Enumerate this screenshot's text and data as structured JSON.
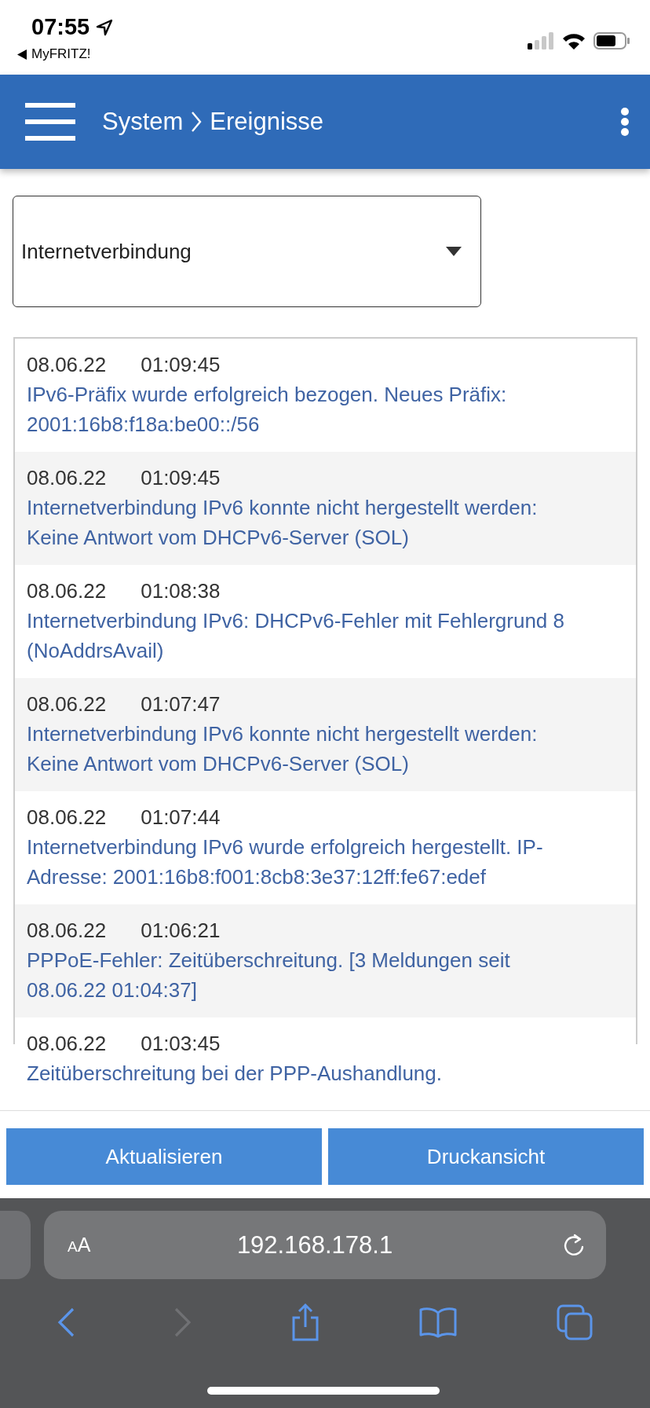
{
  "status_bar": {
    "time": "07:55",
    "back_app": "MyFRITZ!"
  },
  "header": {
    "breadcrumb": [
      "System",
      "Ereignisse"
    ]
  },
  "filter": {
    "value": "Internetverbindung"
  },
  "events": [
    {
      "date": "08.06.22",
      "time": "01:09:45",
      "message": "IPv6-Präfix wurde erfolgreich bezogen. Neues Präfix: 2001:16b8:f18a:be00::/56"
    },
    {
      "date": "08.06.22",
      "time": "01:09:45",
      "message": "Internetverbindung IPv6 konnte nicht hergestellt werden: Keine Antwort vom DHCPv6-Server (SOL)"
    },
    {
      "date": "08.06.22",
      "time": "01:08:38",
      "message": "Internetverbindung IPv6: DHCPv6-Fehler mit Fehlergrund 8 (NoAddrsAvail)"
    },
    {
      "date": "08.06.22",
      "time": "01:07:47",
      "message": "Internetverbindung IPv6 konnte nicht hergestellt werden: Keine Antwort vom DHCPv6-Server (SOL)"
    },
    {
      "date": "08.06.22",
      "time": "01:07:44",
      "message": "Internetverbindung IPv6 wurde erfolgreich hergestellt. IP-Adresse: 2001:16b8:f001:8cb8:3e37:12ff:fe67:edef"
    },
    {
      "date": "08.06.22",
      "time": "01:06:21",
      "message": "PPPoE-Fehler: Zeitüberschreitung. [3 Meldungen seit 08.06.22 01:04:37]"
    },
    {
      "date": "08.06.22",
      "time": "01:03:45",
      "message": "Zeitüberschreitung bei der PPP-Aushandlung."
    }
  ],
  "buttons": [
    "Aktualisieren",
    "Druckansicht"
  ],
  "browser": {
    "text_size": "AA",
    "url": "192.168.178.1",
    "back_enabled": true,
    "forward_enabled": false
  }
}
